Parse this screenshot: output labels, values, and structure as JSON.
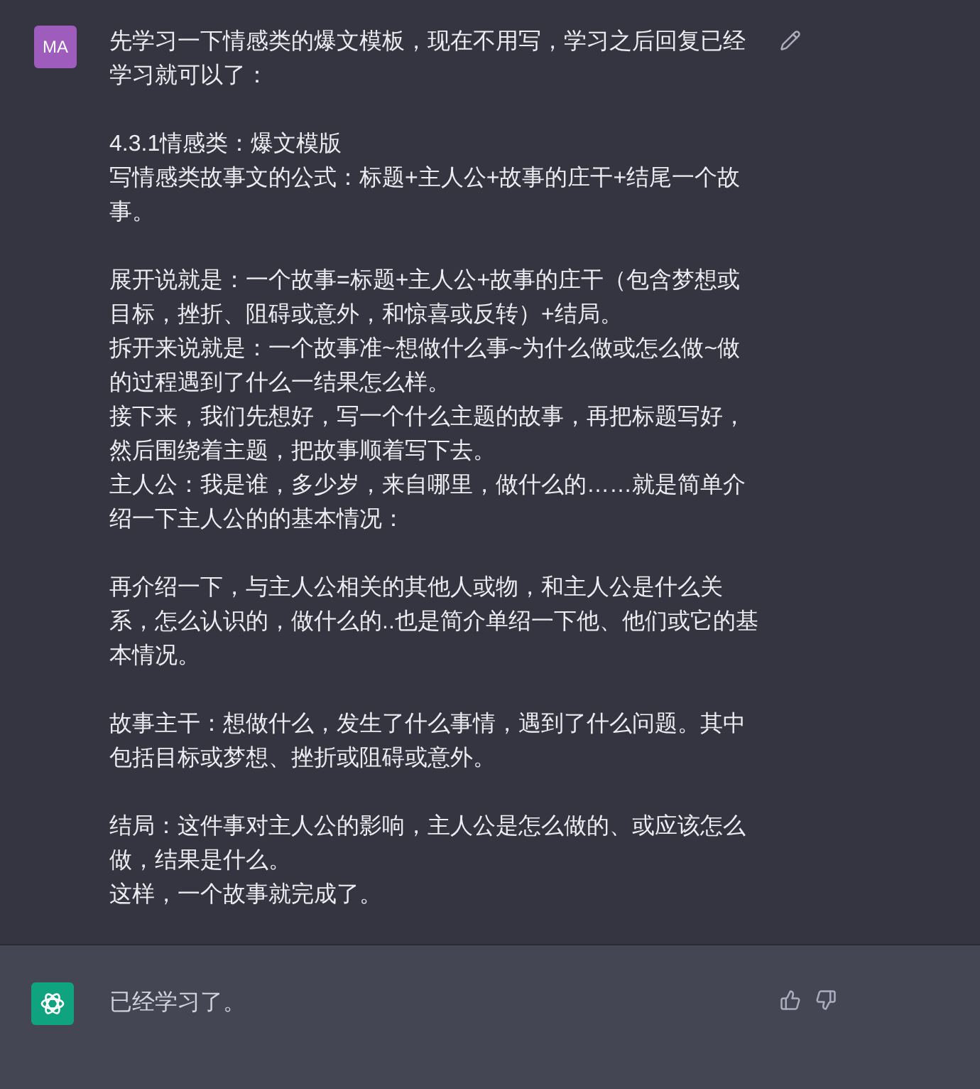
{
  "user_message": {
    "avatar": "MA",
    "paragraphs": [
      [
        "先学习一下情感类的爆文模板，现在不用写，学习之后回复已经学习就可以了："
      ],
      [
        "4.3.1情感类：爆文模版",
        "写情感类故事文的公式：标题+主人公+故事的庄干+结尾一个故事。"
      ],
      [
        "展开说就是：一个故事=标题+主人公+故事的庄干（包含梦想或目标，挫折、阻碍或意外，和惊喜或反转）+结局。",
        "拆开来说就是：一个故事准~想做什么事~为什么做或怎么做~做的过程遇到了什么一结果怎么样。",
        "接下来，我们先想好，写一个什么主题的故事，再把标题写好，然后围绕着主题，把故事顺着写下去。",
        "主人公：我是谁，多少岁，来自哪里，做什么的……就是简单介绍一下主人公的的基本情况："
      ],
      [
        "再介绍一下，与主人公相关的其他人或物，和主人公是什么关系，怎么认识的，做什么的..也是简介单绍一下他、他们或它的基本情况。"
      ],
      [
        "故事主干：想做什么，发生了什么事情，遇到了什么问题。其中包括目标或梦想、挫折或阻碍或意外。"
      ],
      [
        "结局：这件事对主人公的影响，主人公是怎么做的、或应该怎么做，结果是什么。",
        "这样，一个故事就完成了。"
      ]
    ]
  },
  "assistant_message": {
    "text": "已经学习了。"
  }
}
